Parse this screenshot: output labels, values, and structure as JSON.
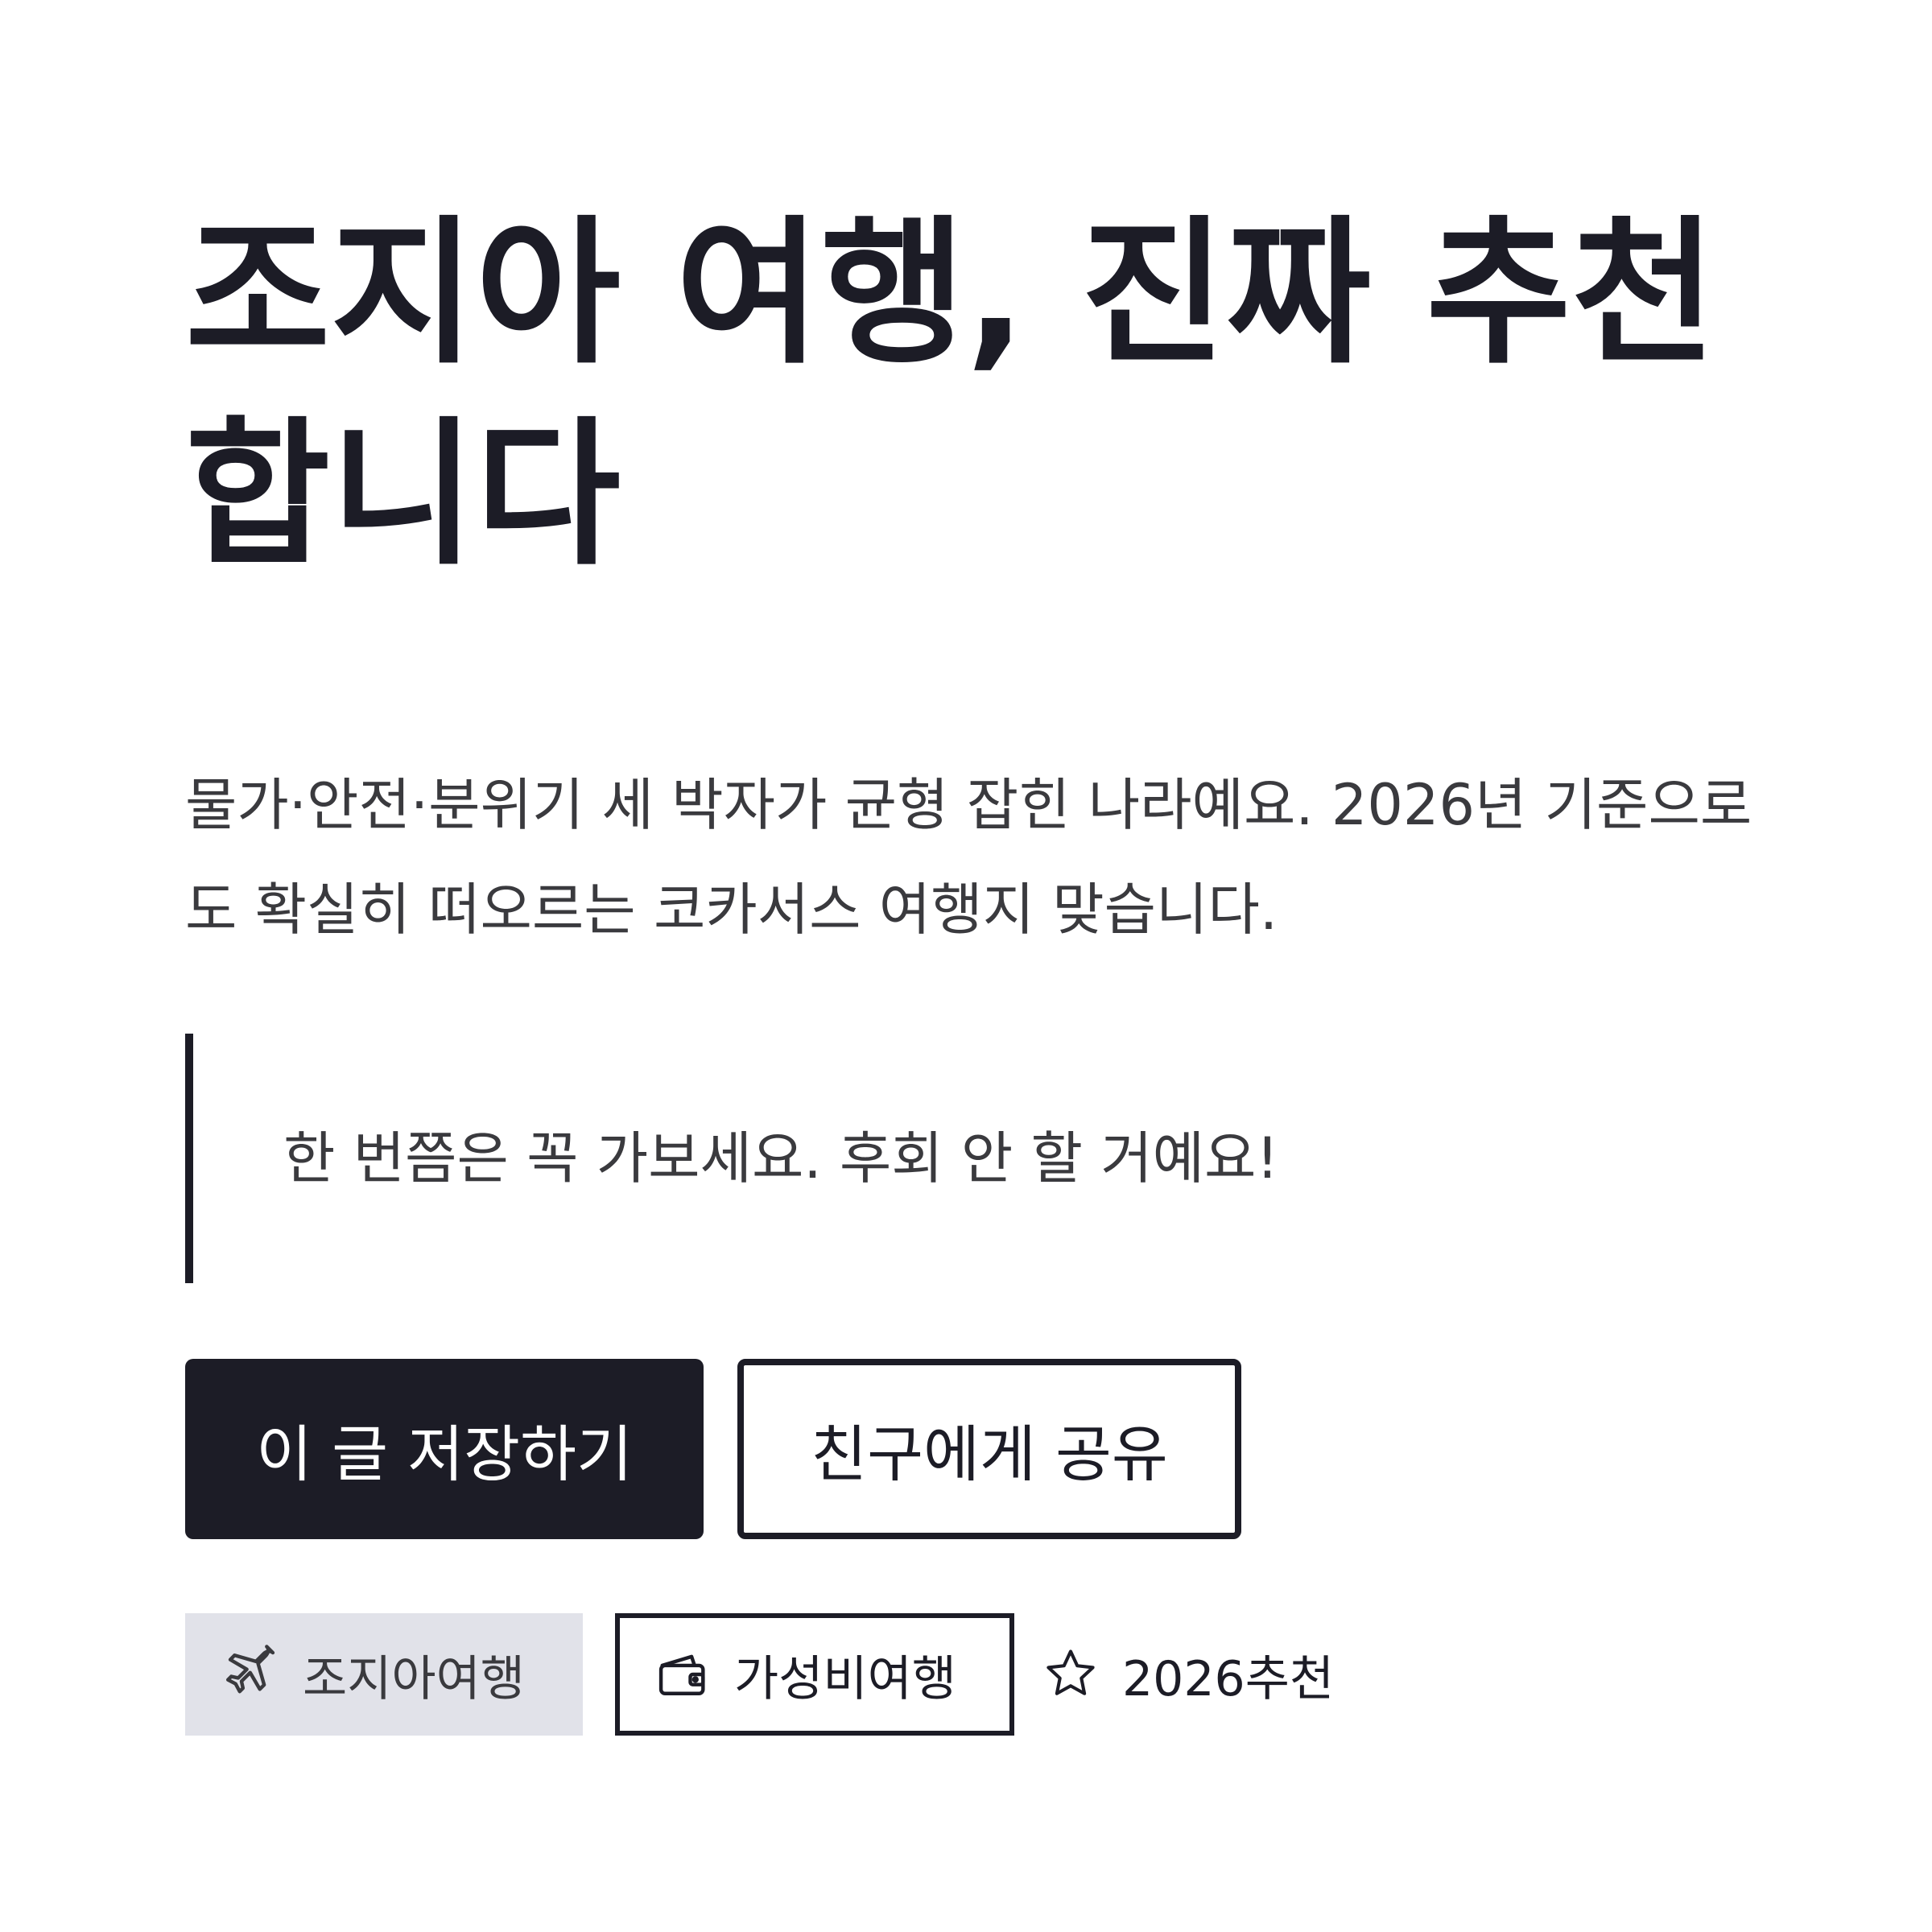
{
  "article": {
    "title": "조지아 여행, 진짜 추천합니다",
    "description": "물가·안전·분위기 세 박자가 균형 잡힌 나라예요. 2026년 기준으로도 확실히 떠오르는 코카서스 여행지 맞습니다.",
    "quote": "한 번쯤은 꼭 가보세요. 후회 안 할 거예요!"
  },
  "actions": {
    "save_label": "이 글 저장하기",
    "share_label": "친구에게 공유"
  },
  "tags": [
    {
      "label": "조지아여행",
      "icon": "airplane-icon",
      "style": "filled"
    },
    {
      "label": "가성비여행",
      "icon": "wallet-icon",
      "style": "outline"
    },
    {
      "label": "2026추천",
      "icon": "star-icon",
      "style": "plain"
    }
  ],
  "colors": {
    "primary": "#1c1c26",
    "text_secondary": "#3a3a3e",
    "tag_fill": "#e1e2e9",
    "background": "#ffffff"
  }
}
